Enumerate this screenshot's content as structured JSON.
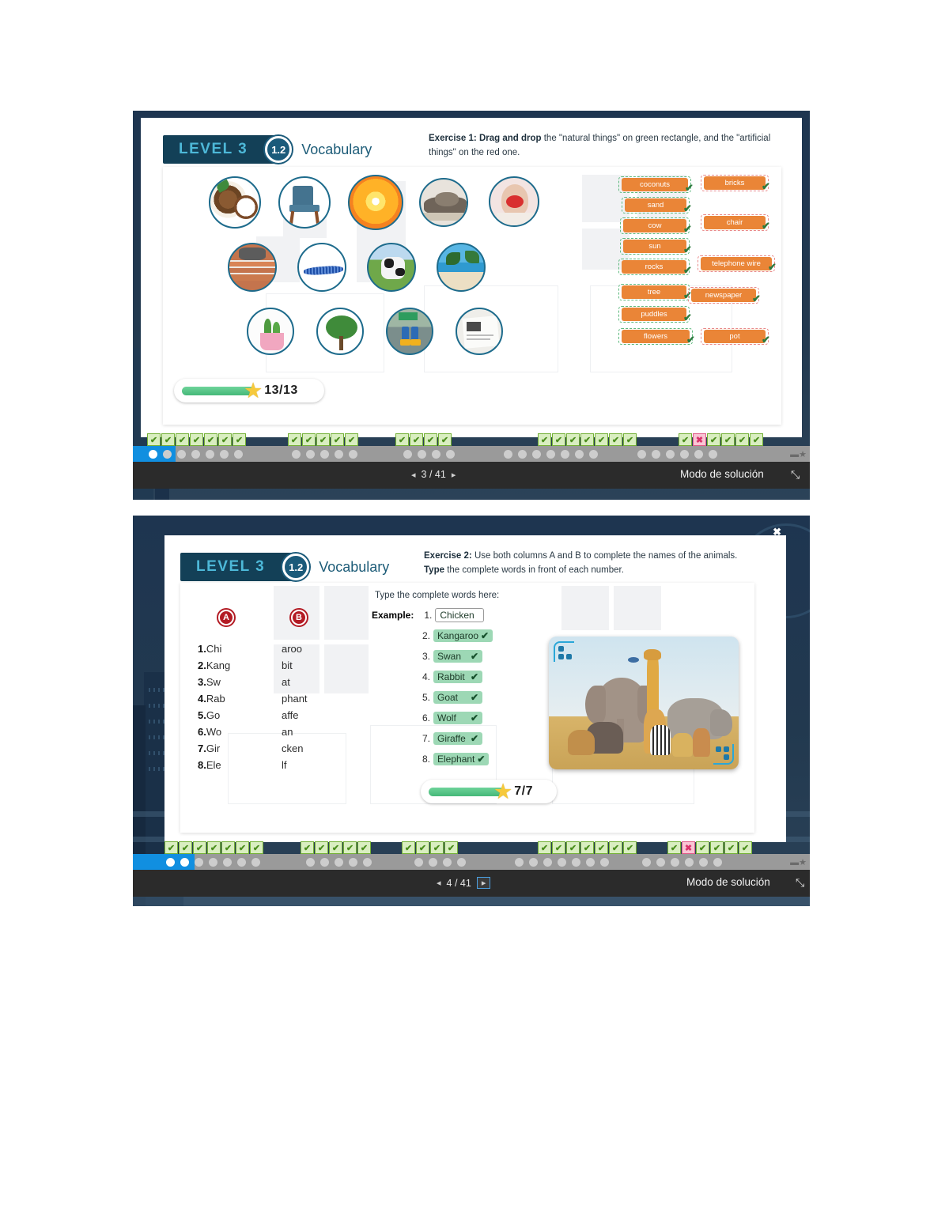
{
  "screen1": {
    "header": {
      "level": "LEVEL 3",
      "unit": "1.2",
      "subject": "Vocabulary"
    },
    "instruction": {
      "prefix": "Exercise 1:",
      "bold2": "Drag and drop",
      "rest": " the \"natural things\" on green rectangle, and the \"artificial things\" on the red one."
    },
    "pictures": [
      {
        "name": "coconuts"
      },
      {
        "name": "chair"
      },
      {
        "name": "sun"
      },
      {
        "name": "rocks"
      },
      {
        "name": "woman-with-flower"
      },
      {
        "name": "bricks"
      },
      {
        "name": "telephone-wire"
      },
      {
        "name": "cow"
      },
      {
        "name": "beach-palms"
      },
      {
        "name": "potted-cactus"
      },
      {
        "name": "tree"
      },
      {
        "name": "puddles-boots"
      },
      {
        "name": "newspaper"
      }
    ],
    "natural_tags": [
      "coconuts",
      "sand",
      "cow",
      "sun",
      "rocks",
      "tree",
      "puddles",
      "flowers"
    ],
    "artificial_tags": [
      "bricks",
      "chair",
      "telephone wire",
      "newspaper",
      "pot"
    ],
    "score": {
      "text": "13/13",
      "percent": 100
    },
    "progress_groups": [
      {
        "marks": [
          "ok",
          "ok",
          "ok",
          "ok",
          "ok",
          "ok",
          "ok"
        ]
      },
      {
        "marks": [
          "ok",
          "ok",
          "ok",
          "ok",
          "ok"
        ]
      },
      {
        "marks": [
          "ok",
          "ok",
          "ok",
          "ok"
        ]
      },
      {
        "marks": [
          "ok",
          "ok",
          "ok",
          "ok",
          "ok",
          "ok",
          "ok"
        ]
      },
      {
        "marks": [
          "ok",
          "bad",
          "ok",
          "ok",
          "ok",
          "ok"
        ]
      }
    ],
    "toolbar": {
      "page": "3 / 41",
      "prev": "◂",
      "next": "▸",
      "mode": "Modo de solución"
    }
  },
  "screen2": {
    "header": {
      "level": "LEVEL 3",
      "unit": "1.2",
      "subject": "Vocabulary"
    },
    "instruction": {
      "prefix": "Exercise 2:",
      "rest1": " Use both columns A and B to complete the names of the animals. ",
      "bold2": "Type",
      "rest2": " the complete words in front of each number."
    },
    "column_a": {
      "label": "A",
      "items": [
        {
          "num": "1.",
          "frag": "Chi"
        },
        {
          "num": "2.",
          "frag": "Kang"
        },
        {
          "num": "3.",
          "frag": "Sw"
        },
        {
          "num": "4.",
          "frag": "Rab"
        },
        {
          "num": "5.",
          "frag": "Go"
        },
        {
          "num": "6.",
          "frag": "Wo"
        },
        {
          "num": "7.",
          "frag": "Gir"
        },
        {
          "num": "8.",
          "frag": "Ele"
        }
      ]
    },
    "column_b": {
      "label": "B",
      "items": [
        "aroo",
        "bit",
        "at",
        "phant",
        "affe",
        "an",
        "cken",
        "lf"
      ]
    },
    "answers": {
      "prompt": "Type the complete words here:",
      "example_label": "Example:",
      "rows": [
        {
          "num": "1.",
          "word": "Chicken",
          "status": "example"
        },
        {
          "num": "2.",
          "word": "Kangaroo",
          "status": "correct"
        },
        {
          "num": "3.",
          "word": "Swan",
          "status": "correct"
        },
        {
          "num": "4.",
          "word": "Rabbit",
          "status": "correct"
        },
        {
          "num": "5.",
          "word": "Goat",
          "status": "correct"
        },
        {
          "num": "6.",
          "word": "Wolf",
          "status": "correct"
        },
        {
          "num": "7.",
          "word": "Giraffe",
          "status": "correct"
        },
        {
          "num": "8.",
          "word": "Elephant",
          "status": "correct"
        }
      ]
    },
    "photo": {
      "name": "savanna-animals-photo"
    },
    "score": {
      "text": "7/7",
      "percent": 100
    },
    "progress_groups": [
      {
        "marks": [
          "ok",
          "ok",
          "ok",
          "ok",
          "ok",
          "ok",
          "ok"
        ]
      },
      {
        "marks": [
          "ok",
          "ok",
          "ok",
          "ok",
          "ok"
        ]
      },
      {
        "marks": [
          "ok",
          "ok",
          "ok",
          "ok"
        ]
      },
      {
        "marks": [
          "ok",
          "ok",
          "ok",
          "ok",
          "ok",
          "ok",
          "ok"
        ]
      },
      {
        "marks": [
          "ok",
          "bad",
          "ok",
          "ok",
          "ok",
          "ok"
        ]
      }
    ],
    "toolbar": {
      "page": "4 / 41",
      "prev": "◂",
      "next": "▸",
      "mode": "Modo de solución"
    },
    "close": "✖"
  },
  "glyphs": {
    "check": "✔",
    "cross": "✖",
    "star": "★",
    "expand": "⤡"
  }
}
